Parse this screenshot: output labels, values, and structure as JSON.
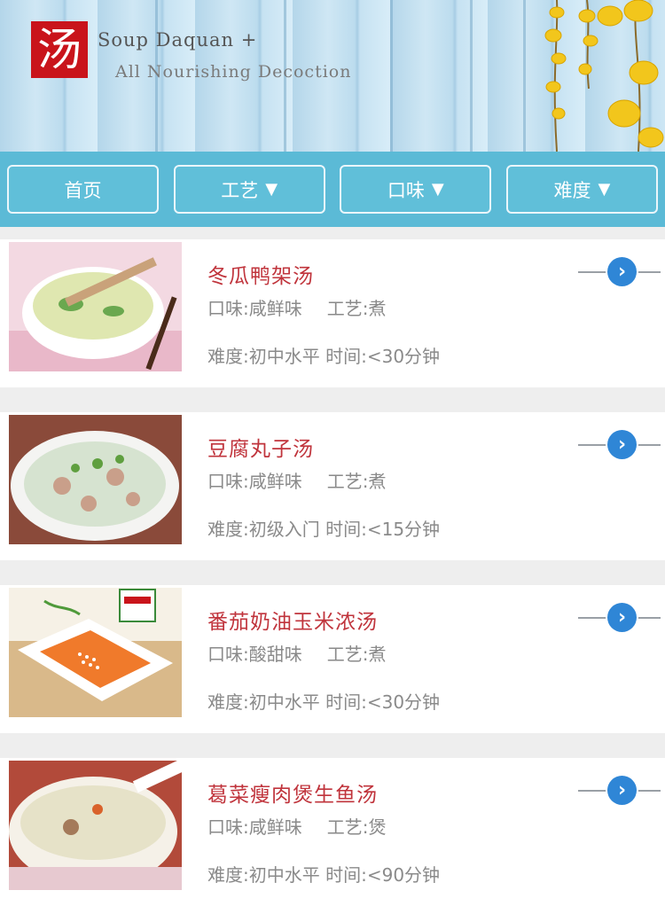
{
  "header": {
    "logo_char": "汤",
    "brand_line1": "Soup Daquan +",
    "brand_line2": "All Nourishing Decoction"
  },
  "filters": [
    {
      "label": "首页",
      "has_dropdown": false
    },
    {
      "label": "工艺",
      "has_dropdown": true
    },
    {
      "label": "口味",
      "has_dropdown": true
    },
    {
      "label": "难度",
      "has_dropdown": true
    }
  ],
  "dropdown_icon": "▼",
  "recipes": [
    {
      "title": "冬瓜鸭架汤",
      "taste": "口味:咸鲜味",
      "craft": "工艺:煮",
      "difficulty": "难度:初中水平",
      "time": "时间:<30分钟"
    },
    {
      "title": "豆腐丸子汤",
      "taste": "口味:咸鲜味",
      "craft": "工艺:煮",
      "difficulty": "难度:初级入门",
      "time": "时间:<15分钟"
    },
    {
      "title": "番茄奶油玉米浓汤",
      "taste": "口味:酸甜味",
      "craft": "工艺:煮",
      "difficulty": "难度:初中水平",
      "time": "时间:<30分钟"
    },
    {
      "title": "葛菜瘦肉煲生鱼汤",
      "taste": "口味:咸鲜味",
      "craft": "工艺:煲",
      "difficulty": "难度:初中水平",
      "time": "时间:<90分钟"
    }
  ],
  "colors": {
    "accent": "#5bbad6",
    "title_red": "#c0343c",
    "logo_red": "#c9141b",
    "arrow_blue": "#2f86d6"
  }
}
